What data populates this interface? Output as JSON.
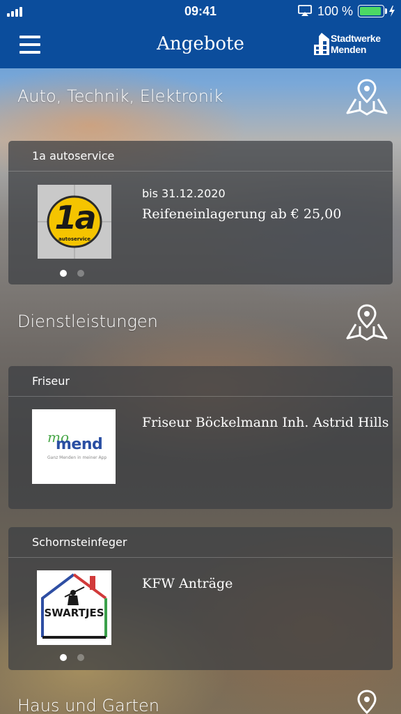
{
  "status_bar": {
    "time": "09:41",
    "battery_percent": "100 %",
    "battery_color": "#4cd964"
  },
  "nav": {
    "title": "Angebote",
    "menu_icon": "hamburger-menu-icon",
    "brand_line1": "Stadtwerke",
    "brand_line2": "Menden",
    "background": "#0b4d9c"
  },
  "sections": [
    {
      "title": "Auto, Technik, Elektronik",
      "map_icon": "map-pin-icon",
      "cards": [
        {
          "category": "1a autoservice",
          "date": "bis 31.12.2020",
          "title": "Reifeneinlagerung ab € 25,00",
          "logo": "1a autoservice logo",
          "logo_text": "1a",
          "logo_subtext": "autoservice",
          "pager": {
            "count": 2,
            "active": 0
          }
        }
      ]
    },
    {
      "title": "Dienstleistungen",
      "map_icon": "map-pin-icon",
      "cards": [
        {
          "category": "Friseur",
          "title": "Friseur Böckelmann Inh. Astrid Hills",
          "logo": "mo mend logo",
          "logo_text_top": "mo",
          "logo_text_main": "mend",
          "logo_tagline": "Ganz Menden in meiner App"
        },
        {
          "category": "Schornsteinfeger",
          "title": "KFW Anträge",
          "logo": "swartjes logo",
          "logo_text": "SWARTJES",
          "pager": {
            "count": 2,
            "active": 0
          }
        }
      ]
    },
    {
      "title": "Haus und Garten",
      "map_icon": "map-pin-icon"
    }
  ]
}
